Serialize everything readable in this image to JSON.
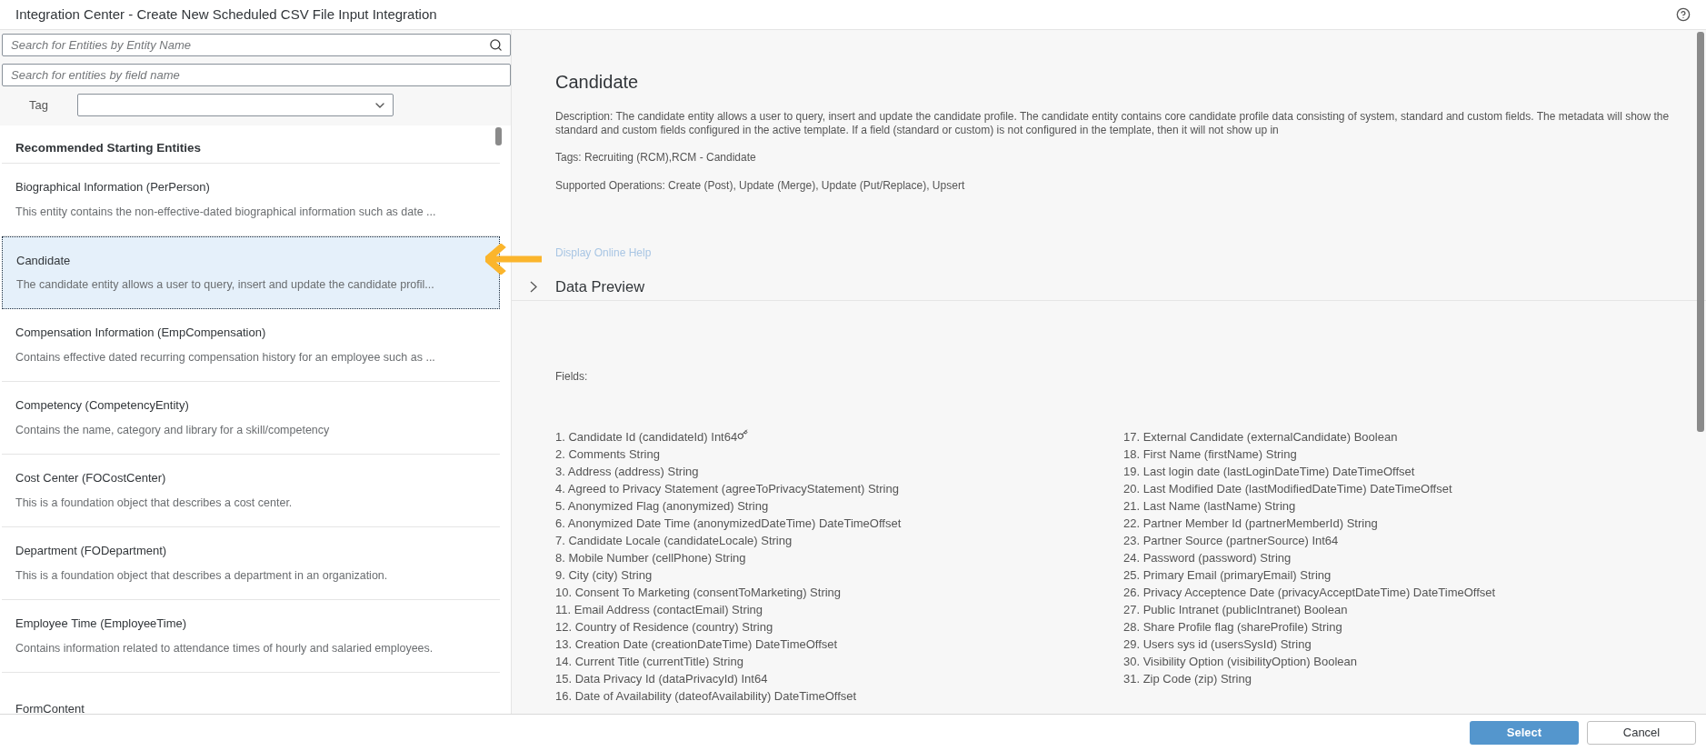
{
  "window": {
    "title": "Integration Center - Create New Scheduled CSV File Input Integration"
  },
  "filters": {
    "entity_search": {
      "placeholder": "Search for Entities by Entity Name"
    },
    "field_search": {
      "placeholder": "Search for entities by field name"
    },
    "tag": {
      "label": "Tag"
    }
  },
  "entity_list": {
    "heading": "Recommended Starting Entities",
    "items": [
      {
        "name": "Biographical Information (PerPerson)",
        "description": "This entity contains the non-effective-dated biographical information such as date ...",
        "selected": false
      },
      {
        "name": "Candidate",
        "description": "The candidate entity allows a user to query, insert and update the candidate profil...",
        "selected": true
      },
      {
        "name": "Compensation Information (EmpCompensation)",
        "description": "Contains effective dated recurring compensation history for an employee such as ...",
        "selected": false
      },
      {
        "name": "Competency (CompetencyEntity)",
        "description": "Contains the name, category and library for a skill/competency",
        "selected": false
      },
      {
        "name": "Cost Center (FOCostCenter)",
        "description": "This is a foundation object that describes a cost center.",
        "selected": false
      },
      {
        "name": "Department (FODepartment)",
        "description": "This is a foundation object that describes a department in an organization.",
        "selected": false
      },
      {
        "name": "Employee Time (EmployeeTime)",
        "description": "Contains information related to attendance times of hourly and salaried employees.",
        "selected": false
      },
      {
        "name": "FormContent",
        "selected": false
      }
    ]
  },
  "detail": {
    "title": "Candidate",
    "description": "Description: The candidate entity allows a user to query, insert and update the candidate profile. The candidate entity contains core candidate profile data consisting of system, standard and custom fields. The metadata will show the standard and custom fields configured in the active template. If a field (standard or custom) is not configured in the template, then it will not show up in",
    "tags": "Tags: Recruiting (RCM),RCM - Candidate",
    "operations": "Supported Operations: Create (Post), Update (Merge), Update (Put/Replace), Upsert",
    "help_link": "Display Online Help",
    "data_preview": {
      "label": "Data Preview",
      "expanded": false
    },
    "fields_label": "Fields:",
    "fields_columns": [
      [
        {
          "text": "1. Candidate Id (candidateId) Int64",
          "key": true
        },
        {
          "text": "2. Comments String",
          "key": false
        },
        {
          "text": "3. Address (address) String",
          "key": false
        },
        {
          "text": "4. Agreed to Privacy Statement (agreeToPrivacyStatement) String",
          "key": false
        },
        {
          "text": "5. Anonymized Flag (anonymized) String",
          "key": false
        },
        {
          "text": "6. Anonymized Date Time (anonymizedDateTime) DateTimeOffset",
          "key": false
        },
        {
          "text": "7. Candidate Locale (candidateLocale) String",
          "key": false
        },
        {
          "text": "8. Mobile Number (cellPhone) String",
          "key": false
        },
        {
          "text": "9. City (city) String",
          "key": false
        },
        {
          "text": "10. Consent To Marketing (consentToMarketing) String",
          "key": false
        },
        {
          "text": "11. Email Address (contactEmail) String",
          "key": false
        },
        {
          "text": "12. Country of Residence (country) String",
          "key": false
        },
        {
          "text": "13. Creation Date (creationDateTime) DateTimeOffset",
          "key": false
        },
        {
          "text": "14. Current Title (currentTitle) String",
          "key": false
        },
        {
          "text": "15. Data Privacy Id (dataPrivacyId) Int64",
          "key": false
        },
        {
          "text": "16. Date of Availability (dateofAvailability) DateTimeOffset",
          "key": false
        }
      ],
      [
        {
          "text": "17. External Candidate (externalCandidate) Boolean",
          "key": false
        },
        {
          "text": "18. First Name (firstName) String",
          "key": false
        },
        {
          "text": "19. Last login date (lastLoginDateTime) DateTimeOffset",
          "key": false
        },
        {
          "text": "20. Last Modified Date (lastModifiedDateTime) DateTimeOffset",
          "key": false
        },
        {
          "text": "21. Last Name (lastName) String",
          "key": false
        },
        {
          "text": "22. Partner Member Id (partnerMemberId) String",
          "key": false
        },
        {
          "text": "23. Partner Source (partnerSource) Int64",
          "key": false
        },
        {
          "text": "24. Password (password) String",
          "key": false
        },
        {
          "text": "25. Primary Email (primaryEmail) String",
          "key": false
        },
        {
          "text": "26. Privacy Acceptence Date (privacyAcceptDateTime) DateTimeOffset",
          "key": false
        },
        {
          "text": "27. Public Intranet (publicIntranet) Boolean",
          "key": false
        },
        {
          "text": "28. Share Profile flag (shareProfile) String",
          "key": false
        },
        {
          "text": "29. Users sys id (usersSysId) String",
          "key": false
        },
        {
          "text": "30. Visibility Option (visibilityOption) Boolean",
          "key": false
        },
        {
          "text": "31. Zip Code (zip) String",
          "key": false
        }
      ]
    ]
  },
  "footer": {
    "buttons": [
      {
        "label": "Select",
        "kind": "primary"
      },
      {
        "label": "Cancel",
        "kind": "secondary"
      }
    ]
  }
}
